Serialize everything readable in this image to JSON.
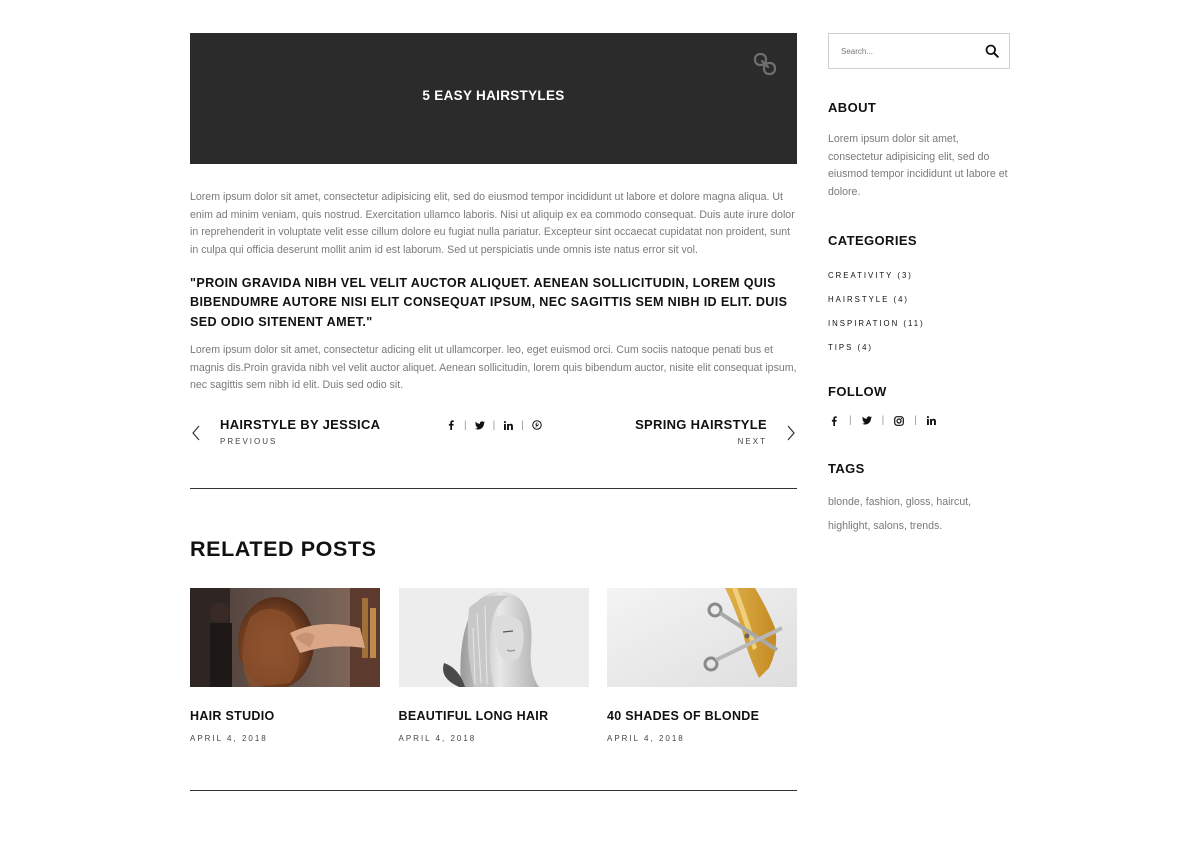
{
  "post": {
    "banner_title": "5 EASY HAIRSTYLES",
    "paragraph1": "Lorem ipsum dolor sit amet, consectetur adipisicing elit, sed do eiusmod tempor incididunt ut labore et dolore magna aliqua. Ut enim ad minim veniam, quis nostrud. Exercitation ullamco laboris. Nisi ut aliquip ex ea commodo consequat. Duis aute irure dolor in reprehenderit in voluptate velit esse cillum dolore eu fugiat nulla pariatur. Excepteur sint occaecat cupidatat non proident, sunt in culpa qui officia deserunt mollit anim id est laborum. Sed ut perspiciatis unde omnis iste natus error sit vol.",
    "quote": "\"PROIN GRAVIDA NIBH VEL VELIT AUCTOR ALIQUET. AENEAN SOLLICITUDIN, LOREM QUIS BIBENDUMRE AUTORE NISI ELIT CONSEQUAT IPSUM, NEC SAGITTIS SEM NIBH ID ELIT. DUIS SED ODIO SITENENT AMET.\"",
    "paragraph2": "Lorem ipsum dolor sit amet, consectetur adicing elit ut ullamcorper. leo, eget euismod orci. Cum sociis natoque penati bus et magnis dis.Proin gravida nibh vel velit auctor aliquet. Aenean sollicitudin, lorem quis bibendum auctor, nisite elit consequat ipsum, nec sagittis sem nibh id elit. Duis sed odio sit."
  },
  "post_nav": {
    "prev_title": "HAIRSTYLE BY JESSICA",
    "prev_label": "PREVIOUS",
    "next_title": "SPRING HAIRSTYLE",
    "next_label": "NEXT",
    "share_icons": [
      "facebook-icon",
      "twitter-icon",
      "linkedin-icon",
      "pinterest-icon"
    ]
  },
  "related": {
    "heading": "RELATED POSTS",
    "posts": [
      {
        "title": "HAIR STUDIO",
        "date": "APRIL 4, 2018",
        "image": "hair-studio-photo"
      },
      {
        "title": "BEAUTIFUL LONG HAIR",
        "date": "APRIL 4, 2018",
        "image": "long-hair-photo"
      },
      {
        "title": "40 SHADES OF BLONDE",
        "date": "APRIL 4, 2018",
        "image": "scissors-blonde-hair-photo"
      }
    ]
  },
  "sidebar": {
    "search_placeholder": "Search...",
    "about_title": "ABOUT",
    "about_text": "Lorem ipsum dolor sit amet, consectetur adipisicing elit, sed do eiusmod tempor incididunt ut labore et dolore.",
    "categories_title": "CATEGORIES",
    "categories": [
      "CREATIVITY (3)",
      "HAIRSTYLE (4)",
      "INSPIRATION (11)",
      "TIPS (4)"
    ],
    "follow_title": "FOLLOW",
    "follow_icons": [
      "facebook-icon",
      "twitter-icon",
      "instagram-icon",
      "linkedin-icon"
    ],
    "tags_title": "TAGS",
    "tags_line1": "blonde, fashion, gloss, haircut,",
    "tags_line2": "highlight, salons, trends."
  },
  "colors": {
    "banner_bg": "#2b2b2b",
    "body_text": "#7a7a7a",
    "heading": "#111111",
    "divider": "#333333"
  }
}
